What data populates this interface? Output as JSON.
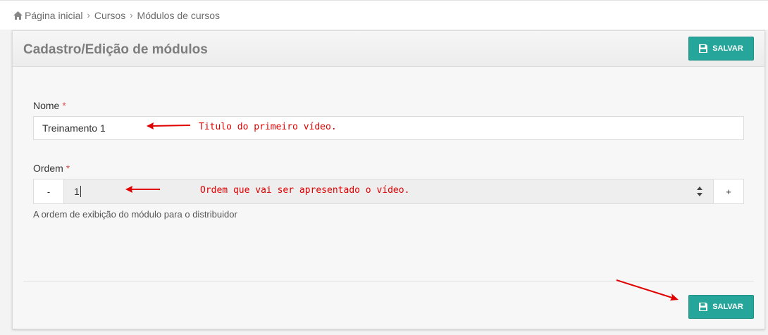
{
  "breadcrumb": {
    "items": [
      "Página inicial",
      "Cursos",
      "Módulos de cursos"
    ]
  },
  "panel": {
    "title": "Cadastro/Edição de módulos",
    "save_label": "SALVAR"
  },
  "form": {
    "nome": {
      "label": "Nome",
      "required_mark": "*",
      "value": "Treinamento 1"
    },
    "ordem": {
      "label": "Ordem",
      "required_mark": "*",
      "value": "1",
      "decrement_label": "-",
      "increment_label": "+",
      "help": "A ordem de exibição do módulo para o distribuidor"
    }
  },
  "annotations": {
    "nome_note": "Titulo do primeiro vídeo.",
    "ordem_note": "Ordem que vai ser apresentado o vídeo."
  },
  "colors": {
    "accent": "#26a69a",
    "annotation": "#e00000",
    "required": "#d9534f"
  }
}
